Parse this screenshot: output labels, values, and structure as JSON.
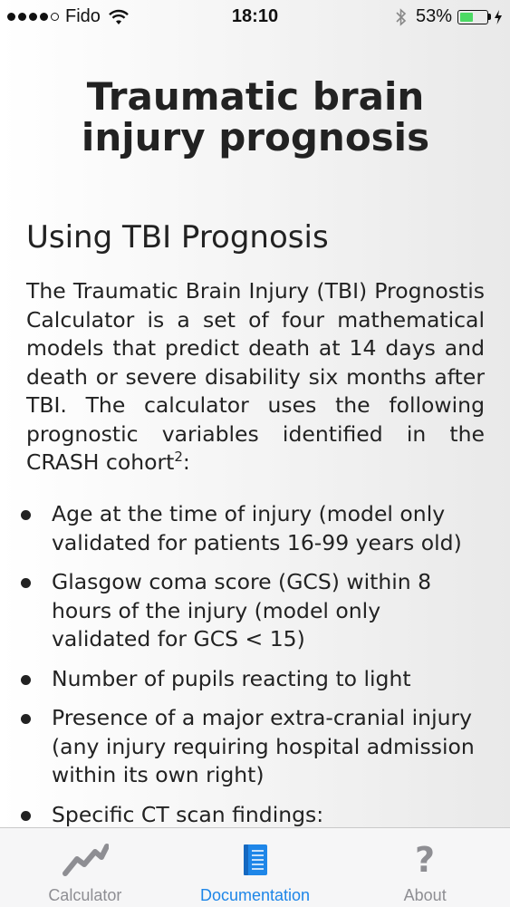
{
  "status_bar": {
    "carrier": "Fido",
    "time": "18:10",
    "battery_percent_label": "53%",
    "battery_level": 0.53,
    "charging": true
  },
  "page": {
    "title": "Traumatic brain injury prognosis",
    "section_heading": "Using TBI Prognosis",
    "intro_text": "The Traumatic Brain Injury (TBI) Prognostis Calculator is a set of four mathematical models that predict death at 14 days and death or severe disability six months after TBI. The calculator uses the following prognostic variables identified in the CRASH cohort",
    "intro_superscript": "2",
    "intro_suffix": ":",
    "bullets": [
      "Age at the time of injury (model only validated for patients 16-99 years old)",
      "Glasgow coma score (GCS) within 8 hours of the injury (model only validated for GCS < 15)",
      "Number of pupils reacting to light",
      "Presence of a major extra-cranial injury (any injury requiring hospital admission within its own right)",
      "Specific CT scan findings:"
    ]
  },
  "tab_bar": {
    "tabs": [
      {
        "label": "Calculator",
        "icon": "chart-line-icon",
        "active": false
      },
      {
        "label": "Documentation",
        "icon": "notebook-icon",
        "active": true
      },
      {
        "label": "About",
        "icon": "question-mark-icon",
        "active": false
      }
    ]
  },
  "colors": {
    "accent": "#1e86e8",
    "inactive": "#8e8e93",
    "battery": "#4cd964"
  }
}
